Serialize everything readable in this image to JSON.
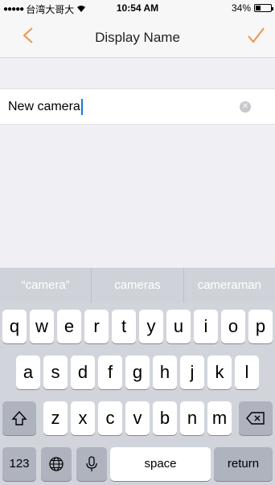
{
  "status_bar": {
    "carrier": "台湾大哥大",
    "time": "10:54 AM",
    "battery_pct": "34%",
    "battery_level": 0.34
  },
  "nav": {
    "title": "Display Name"
  },
  "name_field": {
    "value": "New camera"
  },
  "keyboard": {
    "predictions": [
      "“camera”",
      "cameras",
      "cameraman"
    ],
    "row1": [
      "q",
      "w",
      "e",
      "r",
      "t",
      "y",
      "u",
      "i",
      "o",
      "p"
    ],
    "row2": [
      "a",
      "s",
      "d",
      "f",
      "g",
      "h",
      "j",
      "k",
      "l"
    ],
    "row3": [
      "z",
      "x",
      "c",
      "v",
      "b",
      "n",
      "m"
    ],
    "numbers_key": "123",
    "space_key": "space",
    "return_key": "return"
  },
  "colors": {
    "accent": "#f0944a",
    "cursor": "#1a73e8"
  }
}
